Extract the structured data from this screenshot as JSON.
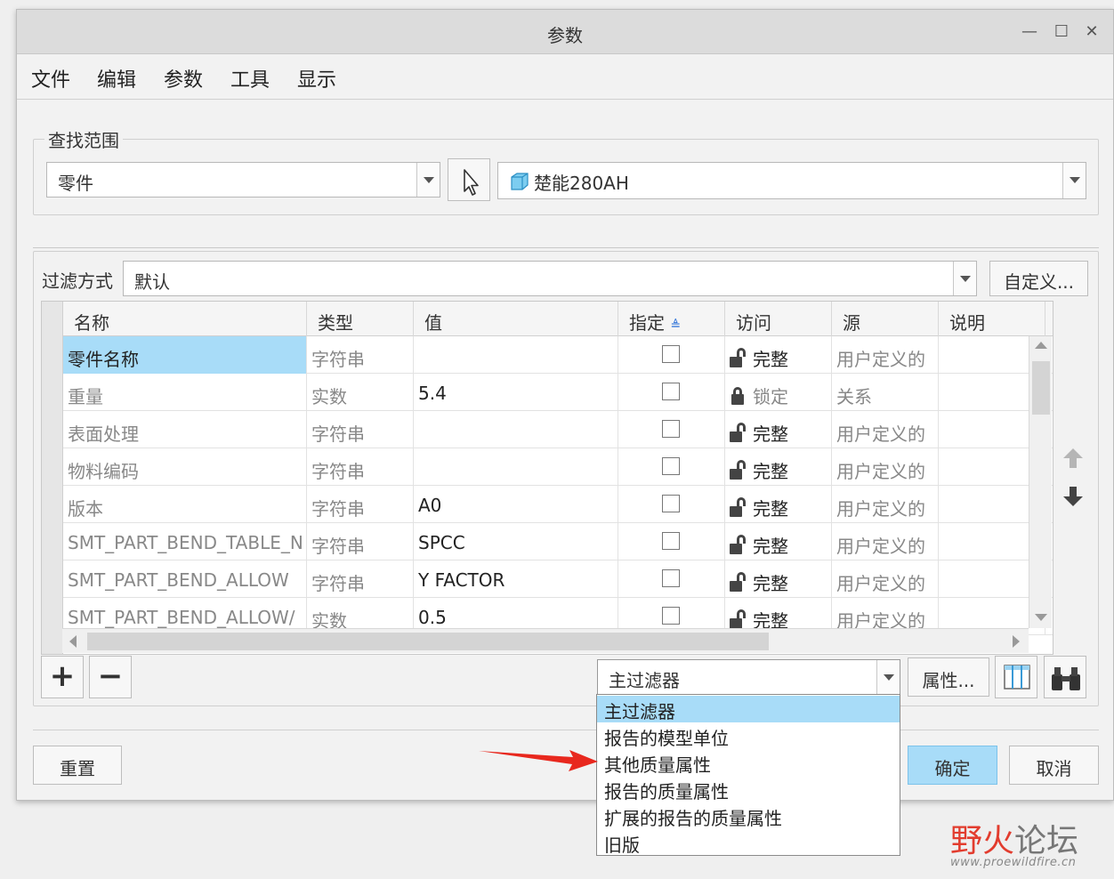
{
  "window": {
    "title": "参数",
    "controls": [
      "—",
      "☐",
      "✕"
    ]
  },
  "menu": [
    "文件",
    "编辑",
    "参数",
    "工具",
    "显示"
  ],
  "scope": {
    "legend": "查找范围",
    "type_value": "零件",
    "model_value": "楚能280AH"
  },
  "filter": {
    "label": "过滤方式",
    "value": "默认",
    "customize_label": "自定义..."
  },
  "table": {
    "columns": [
      "名称",
      "类型",
      "值",
      "指定",
      "访问",
      "源",
      "说明"
    ],
    "sort_indicator": "≜",
    "rows": [
      {
        "name": "零件名称",
        "type": "字符串",
        "value": "",
        "access": "完整",
        "source": "用户定义的",
        "lock": "open"
      },
      {
        "name": "重量",
        "type": "实数",
        "value": "5.4",
        "access": "锁定",
        "source": "关系",
        "lock": "locked"
      },
      {
        "name": "表面处理",
        "type": "字符串",
        "value": "",
        "access": "完整",
        "source": "用户定义的",
        "lock": "open"
      },
      {
        "name": "物料编码",
        "type": "字符串",
        "value": "",
        "access": "完整",
        "source": "用户定义的",
        "lock": "open"
      },
      {
        "name": "版本",
        "type": "字符串",
        "value": "A0",
        "access": "完整",
        "source": "用户定义的",
        "lock": "open"
      },
      {
        "name": "SMT_PART_BEND_TABLE_N",
        "type": "字符串",
        "value": "SPCC",
        "access": "完整",
        "source": "用户定义的",
        "lock": "open"
      },
      {
        "name": "SMT_PART_BEND_ALLOW",
        "type": "字符串",
        "value": "Y FACTOR",
        "access": "完整",
        "source": "用户定义的",
        "lock": "open"
      },
      {
        "name": "SMT_PART_BEND_ALLOW/",
        "type": "实数",
        "value": "0.5",
        "access": "完整",
        "source": "用户定义的",
        "lock": "open"
      }
    ]
  },
  "bottom": {
    "add_label": "+",
    "remove_label": "−",
    "main_filter_value": "主过滤器",
    "properties_label": "属性...",
    "dropdown_options": [
      "主过滤器",
      "报告的模型单位",
      "其他质量属性",
      "报告的质量属性",
      "扩展的报告的质量属性",
      "旧版"
    ]
  },
  "footer": {
    "reset_label": "重置",
    "ok_label": "确定",
    "cancel_label": "取消"
  },
  "watermark": {
    "title_red": "野火",
    "title_gray": "论坛",
    "url": "www.proewildfire.cn"
  },
  "colors": {
    "selection": "#a8dcf8",
    "annotation_arrow": "#e8281e"
  }
}
